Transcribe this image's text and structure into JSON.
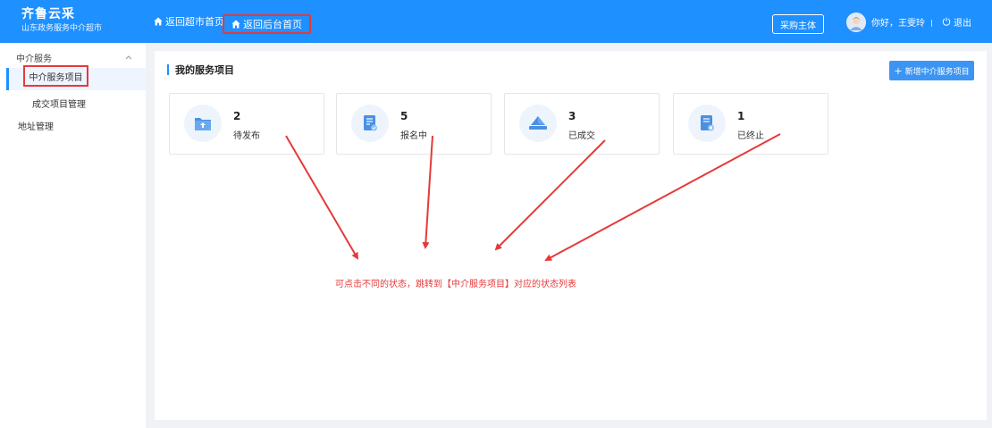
{
  "header": {
    "brand_title": "齐鲁云采",
    "brand_subtitle": "山东政务服务中介超市",
    "nav": [
      {
        "label": "返回超市首页",
        "icon": "home-icon"
      },
      {
        "label": "返回后台首页",
        "icon": "home-icon"
      }
    ],
    "buyer_button": "采购主体",
    "greeting": "你好，王雯玲",
    "logout": "退出",
    "colors": {
      "background": "#1e90ff",
      "highlight_box": "#e6393a"
    }
  },
  "sidebar": {
    "group": {
      "label": "中介服务",
      "icon": "chevron-up-icon"
    },
    "items": [
      {
        "label": "中介服务项目",
        "active": true
      },
      {
        "label": "成交项目管理",
        "active": false
      }
    ],
    "other": [
      {
        "label": "地址管理"
      }
    ]
  },
  "main": {
    "section_title": "我的服务项目",
    "add_button": "新增中介服务项目",
    "cards": [
      {
        "count": "2",
        "label": "待发布",
        "icon": "folder-upload-icon"
      },
      {
        "count": "5",
        "label": "报名中",
        "icon": "document-edit-icon"
      },
      {
        "count": "3",
        "label": "已成交",
        "icon": "deal-icon"
      },
      {
        "count": "1",
        "label": "已终止",
        "icon": "document-stop-icon"
      }
    ]
  },
  "annotation": {
    "text": "可点击不同的状态，跳转到【中介服务项目】对应的状态列表",
    "color": "#e6393a"
  }
}
